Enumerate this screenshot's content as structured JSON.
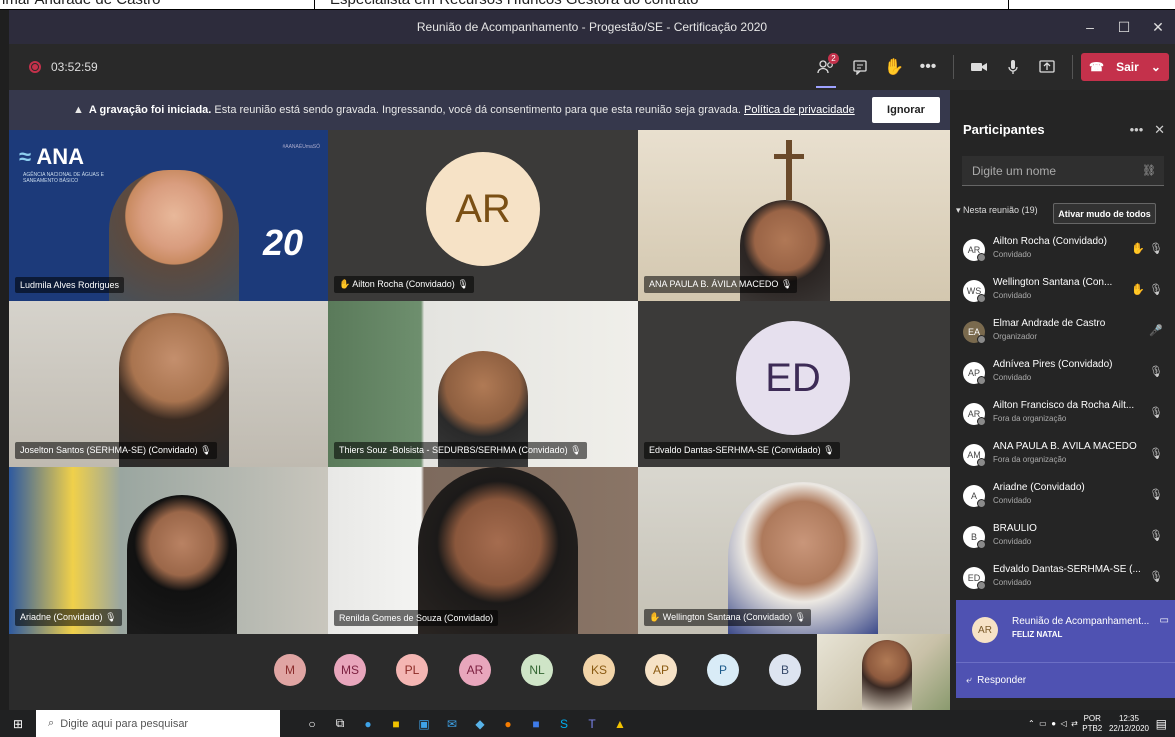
{
  "top_caption": {
    "left": "lmar Andrade de Castro",
    "right": "Especialista em Recursos Hídricos Gestora do contrato"
  },
  "window": {
    "title": "Reunião de Acompanhamento - Progestão/SE - Certificação 2020"
  },
  "toolbar": {
    "timer": "03:52:59",
    "participants_badge": "2",
    "leave_label": "Sair"
  },
  "banner": {
    "bold": "A gravação foi iniciada.",
    "text": "Esta reunião está sendo gravada. Ingressando, você dá consentimento para que esta reunião seja gravada.",
    "link": "Política de privacidade",
    "button": "Ignorar"
  },
  "tiles": [
    {
      "name": "Ludmila Alves Rodrigues",
      "logo": "ANA",
      "logo_sub": "AGÊNCIA NACIONAL DE ÁGUAS E SANEAMENTO BÁSICO",
      "tag": "#AANAÉUmaSÓ",
      "num": "20"
    },
    {
      "name": "Ailton Rocha (Convidado)",
      "initials": "AR"
    },
    {
      "name": "ANA PAULA B. ÁVILA MACEDO"
    },
    {
      "name": "Joselton Santos (SERHMA-SE) (Convidado)"
    },
    {
      "name": "Thiers Souz -Bolsista - SEDURBS/SERHMA (Convidado)"
    },
    {
      "name": "Edvaldo Dantas-SERHMA-SE (Convidado)",
      "initials": "ED"
    },
    {
      "name": "Ariadne (Convidado)"
    },
    {
      "name": "Renilda Gomes de Souza (Convidado)"
    },
    {
      "name": "Wellington Santana (Convidado)"
    }
  ],
  "overflow_chips": [
    "M",
    "MS",
    "PL",
    "AR",
    "NL",
    "KS",
    "AP",
    "P",
    "B"
  ],
  "panel": {
    "title": "Participantes",
    "search_placeholder": "Digite um nome",
    "in_meeting": "Nesta reunião (19)",
    "mute_all": "Ativar mudo de todos",
    "participants": [
      {
        "initials": "AR",
        "name": "Ailton Rocha (Convidado)",
        "role": "Convidado",
        "hand": true
      },
      {
        "initials": "WS",
        "name": "Wellington Santana (Con...",
        "role": "Convidado",
        "hand": true
      },
      {
        "initials": "EA",
        "name": "Elmar Andrade de Castro",
        "role": "Organizador",
        "hand": false
      },
      {
        "initials": "AP",
        "name": "Adnívea Pires (Convidado)",
        "role": "Convidado",
        "hand": false
      },
      {
        "initials": "AR",
        "name": "Ailton Francisco da Rocha Ailt...",
        "role": "Fora da organização",
        "hand": false
      },
      {
        "initials": "AM",
        "name": "ANA PAULA B. ÁVILA MACEDO",
        "role": "Fora da organização",
        "hand": false
      },
      {
        "initials": "A",
        "name": "Ariadne (Convidado)",
        "role": "Convidado",
        "hand": false
      },
      {
        "initials": "B",
        "name": "BRAULIO",
        "role": "Convidado",
        "hand": false
      },
      {
        "initials": "ED",
        "name": "Edvaldo Dantas-SERHMA-SE (...",
        "role": "Convidado",
        "hand": false
      }
    ],
    "notification": {
      "initials": "AR",
      "title": "Reunião de Acompanhament...",
      "message": "FELIZ NATAL",
      "reply": "Responder"
    }
  },
  "taskbar": {
    "search_placeholder": "Digite aqui para pesquisar",
    "lang": "POR",
    "lang2": "PTB2",
    "time": "12:35",
    "date": "22/12/2020"
  }
}
